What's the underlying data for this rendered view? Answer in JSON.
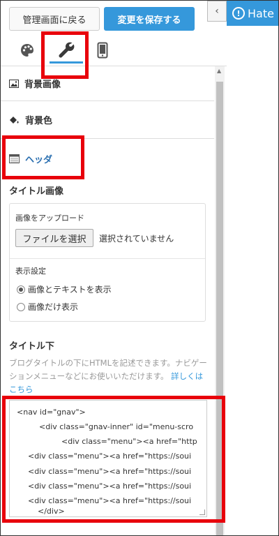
{
  "topbar": {
    "back_label": "管理画面に戻る",
    "save_label": "変更を保存する",
    "collapse_icon": "‹"
  },
  "tabs": [
    {
      "name": "design",
      "icon": "palette-icon"
    },
    {
      "name": "customize",
      "icon": "wrench-icon",
      "active": true
    },
    {
      "name": "smartphone",
      "icon": "smartphone-icon"
    }
  ],
  "sections": {
    "background_image": "背景画像",
    "background_color": "背景色",
    "header": "ヘッダ"
  },
  "title_image": {
    "heading": "タイトル画像",
    "upload_label": "画像をアップロード",
    "file_button": "ファイルを選択",
    "file_status": "選択されていません",
    "display_settings_label": "表示設定",
    "options": [
      {
        "label": "画像とテキストを表示",
        "checked": true
      },
      {
        "label": "画像だけ表示",
        "checked": false
      }
    ]
  },
  "under_title": {
    "heading": "タイトル下",
    "description": "ブログタイトルの下にHTMLを記述できます。ナビゲーションメニューなどにお使いいただけます。",
    "link": "詳しくはこちら",
    "code_lines": [
      "<nav id=\"gnav\">",
      "<div class=\"gnav-inner\" id=\"menu-scro",
      "<div class=\"menu\"><a href=\"http",
      "<div class=\"menu\"><a href=\"https://soui",
      "<div class=\"menu\"><a href=\"https://soui",
      "<div class=\"menu\"><a href=\"https://soui",
      "<div class=\"menu\"><a href=\"https://soui",
      "</div>"
    ]
  },
  "preview": {
    "title": "Hate"
  },
  "colors": {
    "accent": "#3598db",
    "highlight": "#e8000b"
  }
}
